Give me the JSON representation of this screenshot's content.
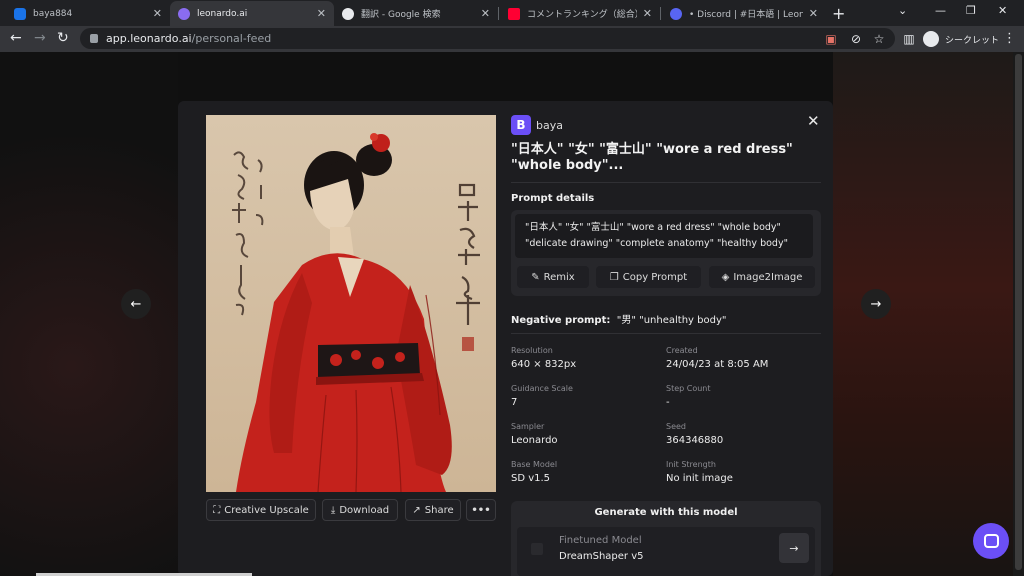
{
  "tabs": [
    {
      "title": "baya884",
      "favicon_color": "#1a73e8"
    },
    {
      "title": "leonardo.ai",
      "favicon_color": "#8a6cf0"
    },
    {
      "title": "翻訳 - Google 検索",
      "favicon_color": "#e8eaed"
    },
    {
      "title": "コメントランキング（総合） - Yahoo",
      "favicon_color": "#ff0033"
    },
    {
      "title": "• Discord | #日本語 | Leonardo",
      "favicon_color": "#5865f2"
    }
  ],
  "address": {
    "host": "app.leonardo.ai",
    "path": "/personal-feed"
  },
  "profile_label": "シークレット",
  "generation": {
    "user_initial": "B",
    "user_name": "baya",
    "title": "\"日本人\" \"女\" \"富士山\" \"wore a red dress\" \"whole body\"...",
    "prompt_details_label": "Prompt details",
    "prompt_text": "\"日本人\" \"女\" \"富士山\" \"wore a red dress\" \"whole body\" \"delicate drawing\" \"complete anatomy\" \"healthy body\"",
    "buttons": {
      "remix": "Remix",
      "copy_prompt": "Copy Prompt",
      "image2image": "Image2Image"
    },
    "negative_label": "Negative prompt:",
    "negative_value": "\"男\" \"unhealthy body\"",
    "meta": [
      {
        "label": "Resolution",
        "value": "640 × 832px"
      },
      {
        "label": "Created",
        "value": "24/04/23 at 8:05 AM"
      },
      {
        "label": "Guidance Scale",
        "value": "7"
      },
      {
        "label": "Step Count",
        "value": "-"
      },
      {
        "label": "Sampler",
        "value": "Leonardo"
      },
      {
        "label": "Seed",
        "value": "364346880"
      },
      {
        "label": "Base Model",
        "value": "SD v1.5"
      },
      {
        "label": "Init Strength",
        "value": "No init image"
      }
    ],
    "generate_title": "Generate with this model",
    "model_label": "Finetuned Model",
    "model_value": "DreamShaper v5"
  },
  "image_actions": {
    "creative_upscale": "Creative Upscale",
    "download": "Download",
    "share": "Share",
    "more": "•••"
  }
}
